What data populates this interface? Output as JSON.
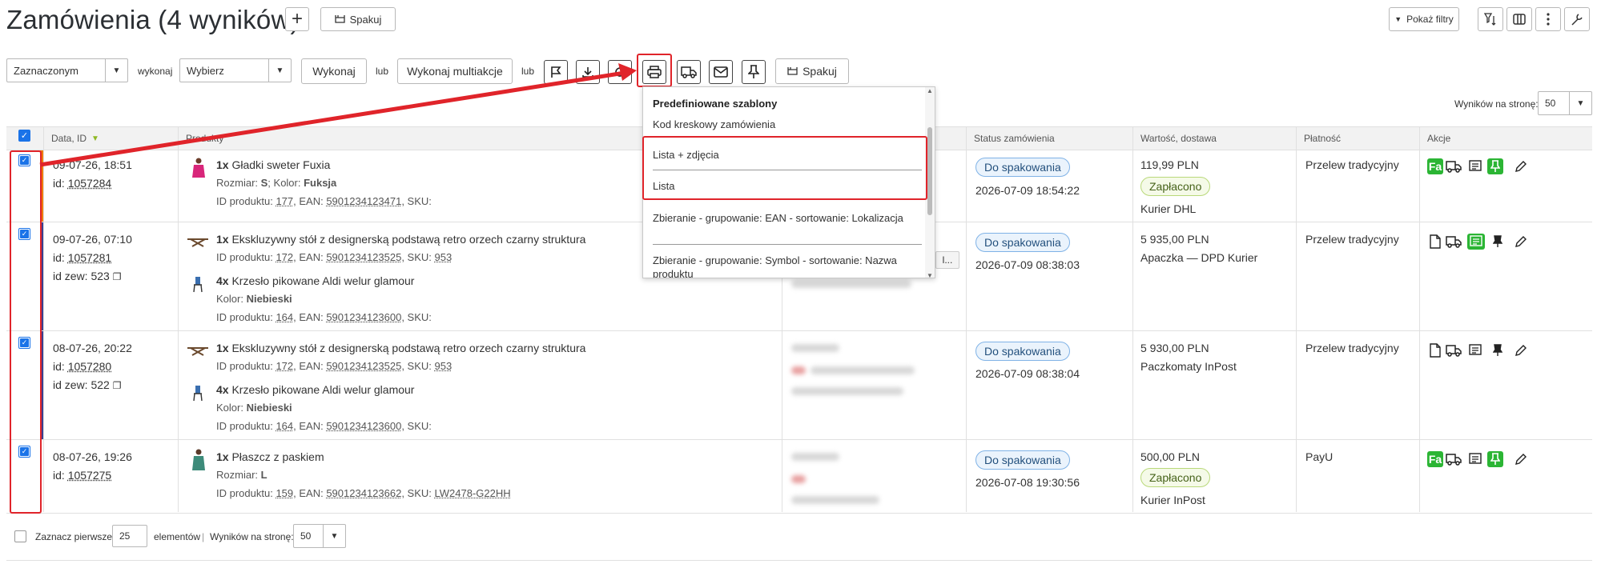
{
  "header": {
    "title": "Zamówienia (4 wyników)",
    "plus_label": "+",
    "spakuj_label": "Spakuj",
    "filters_label": "Pokaż filtry"
  },
  "actions": {
    "scope_select": "Zaznaczonym",
    "wykonaj_text": "wykonaj",
    "action_select": "Wybierz",
    "wykonaj_button": "Wykonaj",
    "lub_1": "lub",
    "multiaction_button": "Wykonaj multiakcje",
    "lub_2": "lub",
    "spakuj_label": "Spakuj"
  },
  "per_page_top": {
    "label": "Wyników na stronę:",
    "value": "50"
  },
  "table": {
    "headers": {
      "date_id": "Data, ID",
      "products": "Produkty",
      "status": "Status zamówienia",
      "value": "Wartość, dostawa",
      "payment": "Płatność",
      "actions": "Akcje"
    },
    "rows": [
      {
        "date": "09-07-26, 18:51",
        "id_label": "id:",
        "id": "1057284",
        "ext_label": "",
        "products": [
          {
            "qty": "1x",
            "name": "Gładki sweter Fuxia",
            "attr_line": {
              "k1": "Rozmiar: ",
              "v1": "S",
              "sep": "; Kolor: ",
              "v2": "Fuksja"
            },
            "id_line": {
              "pre": "ID produktu: ",
              "pid": "177",
              "ean_pre": ", EAN: ",
              "ean": "5901234123471",
              "sku_pre": ", SKU:",
              "sku": ""
            }
          }
        ],
        "status": "Do spakowania",
        "status_time": "2026-07-09 18:54:22",
        "value": "119,99 PLN",
        "paid_badge": "Zapłacono",
        "delivery": "Kurier DHL",
        "payment": "Przelew tradycyjny"
      },
      {
        "date": "09-07-26, 07:10",
        "id_label": "id:",
        "id": "1057281",
        "ext_label": "id zew: 523",
        "products": [
          {
            "qty": "1x",
            "name": "Ekskluzywny stół z designerską podstawą retro orzech czarny struktura",
            "id_line": {
              "pre": "ID produktu: ",
              "pid": "172",
              "ean_pre": ", EAN: ",
              "ean": "5901234123525",
              "sku_pre": ", SKU: ",
              "sku": "953"
            }
          },
          {
            "qty": "4x",
            "name": "Krzesło pikowane Aldi welur glamour",
            "attr_line": {
              "k1": "Kolor: ",
              "v1": "Niebieski"
            },
            "id_line": {
              "pre": "ID produktu: ",
              "pid": "164",
              "ean_pre": ", EAN: ",
              "ean": "5901234123600",
              "sku_pre": ", SKU:",
              "sku": ""
            }
          }
        ],
        "status": "Do spakowania",
        "status_time": "2026-07-09 08:38:03",
        "value": "5 935,00 PLN",
        "delivery": "Apaczka — DPD Kurier",
        "payment": "Przelew tradycyjny",
        "truncated": "l..."
      },
      {
        "date": "08-07-26, 20:22",
        "id_label": "id:",
        "id": "1057280",
        "ext_label": "id zew: 522",
        "products": [
          {
            "qty": "1x",
            "name": "Ekskluzywny stół z designerską podstawą retro orzech czarny struktura",
            "id_line": {
              "pre": "ID produktu: ",
              "pid": "172",
              "ean_pre": ", EAN: ",
              "ean": "5901234123525",
              "sku_pre": ", SKU: ",
              "sku": "953"
            }
          },
          {
            "qty": "4x",
            "name": "Krzesło pikowane Aldi welur glamour",
            "attr_line": {
              "k1": "Kolor: ",
              "v1": "Niebieski"
            },
            "id_line": {
              "pre": "ID produktu: ",
              "pid": "164",
              "ean_pre": ", EAN: ",
              "ean": "5901234123600",
              "sku_pre": ", SKU:",
              "sku": ""
            }
          }
        ],
        "status": "Do spakowania",
        "status_time": "2026-07-09 08:38:04",
        "value": "5 930,00 PLN",
        "delivery": "Paczkomaty InPost",
        "payment": "Przelew tradycyjny"
      },
      {
        "date": "08-07-26, 19:26",
        "id_label": "id:",
        "id": "1057275",
        "ext_label": "",
        "products": [
          {
            "qty": "1x",
            "name": "Płaszcz z paskiem",
            "attr_line": {
              "k1": "Rozmiar: ",
              "v1": "L"
            },
            "id_line": {
              "pre": "ID produktu: ",
              "pid": "159",
              "ean_pre": ", EAN: ",
              "ean": "5901234123662",
              "sku_pre": ", SKU: ",
              "sku": "LW2478-G22HH"
            }
          }
        ],
        "status": "Do spakowania",
        "status_time": "2026-07-08 19:30:56",
        "value": "500,00 PLN",
        "paid_badge": "Zapłacono",
        "delivery": "Kurier InPost",
        "payment": "PayU"
      }
    ]
  },
  "dropdown": {
    "heading": "Predefiniowane szablony",
    "items": [
      "Kod kreskowy zamówienia",
      "Lista + zdjęcia",
      "Lista",
      "Zbieranie - grupowanie: EAN - sortowanie: Lokalizacja",
      "Zbieranie - grupowanie: Symbol - sortowanie: Nazwa produktu"
    ]
  },
  "icons": {
    "invoice_badge": "Fa"
  },
  "footer": {
    "select_first_label": "Zaznacz pierwsze",
    "select_first_value": "25",
    "elements_label": "elementów",
    "divider": "|",
    "per_page_label": "Wyników na stronę:",
    "per_page_value": "50"
  },
  "colors": {
    "highlight_red": "#e0242a",
    "badge_blue_border": "#7fb2e6",
    "badge_green_border": "#b9d97a",
    "action_green": "#2bb534",
    "row_accent_orange": "#f07a00",
    "row_accent_navy": "#3b3f8f"
  }
}
